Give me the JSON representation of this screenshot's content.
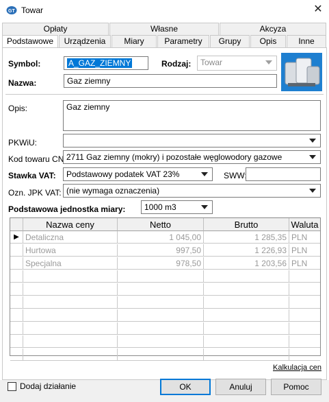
{
  "window": {
    "title": "Towar",
    "icon": "app-logo-icon"
  },
  "tabs_top": [
    {
      "label": "Opłaty"
    },
    {
      "label": "Własne"
    },
    {
      "label": "Akcyza"
    }
  ],
  "tabs_bottom": [
    {
      "label": "Podstawowe",
      "active": true
    },
    {
      "label": "Urządzenia"
    },
    {
      "label": "Miary"
    },
    {
      "label": "Parametry"
    },
    {
      "label": "Grupy"
    },
    {
      "label": "Opis"
    },
    {
      "label": "Inne"
    }
  ],
  "form": {
    "symbol_label": "Symbol:",
    "symbol_value": "A_GAZ_ZIEMNY",
    "rodzaj_label": "Rodzaj:",
    "rodzaj_value": "Towar",
    "nazwa_label": "Nazwa:",
    "nazwa_value": "Gaz ziemny",
    "opis_label": "Opis:",
    "opis_value": "Gaz ziemny",
    "pkwiu_label": "PKWiU:",
    "pkwiu_value": "",
    "cn_label": "Kod towaru CN:",
    "cn_value": "2711 Gaz ziemny (mokry) i pozostałe węglowodory gazowe",
    "vat_label": "Stawka VAT:",
    "vat_value": "Podstawowy podatek VAT 23%",
    "sww_label": "SWW:",
    "sww_value": "",
    "jpk_label": "Ozn. JPK VAT:",
    "jpk_value": "(nie wymaga oznaczenia)",
    "unit_label": "Podstawowa jednostka miary:",
    "unit_value": "1000 m3",
    "product_image": "gas-product-icon"
  },
  "price_grid": {
    "headers": [
      "Nazwa ceny",
      "Netto",
      "Brutto",
      "Waluta"
    ],
    "rows": [
      {
        "name": "Detaliczna",
        "netto": "1 045,00",
        "brutto": "1 285,35",
        "currency": "PLN",
        "current": true
      },
      {
        "name": "Hurtowa",
        "netto": "997,50",
        "brutto": "1 226,93",
        "currency": "PLN"
      },
      {
        "name": "Specjalna",
        "netto": "978,50",
        "brutto": "1 203,56",
        "currency": "PLN"
      }
    ]
  },
  "calc_link": "Kalkulacja cen",
  "footer": {
    "add_action_label": "Dodaj działanie",
    "ok_label": "OK",
    "cancel_label": "Anuluj",
    "help_label": "Pomoc"
  }
}
